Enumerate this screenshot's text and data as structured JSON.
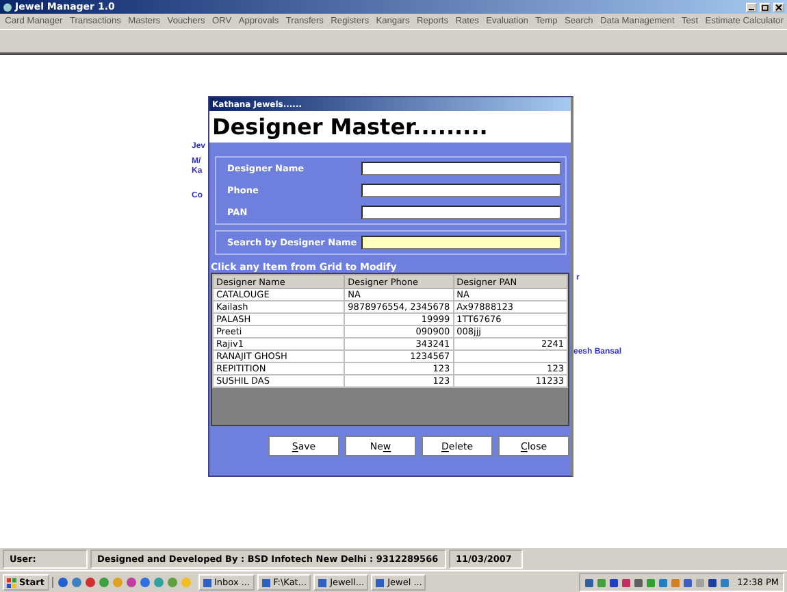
{
  "window": {
    "title": "Jewel Manager 1.0"
  },
  "menu": [
    "Card Manager",
    "Transactions",
    "Masters",
    "Vouchers",
    "ORV",
    "Approvals",
    "Transfers",
    "Registers",
    "Kangars",
    "Reports",
    "Rates",
    "Evaluation",
    "Temp",
    "Search",
    "Data Management",
    "Test",
    "Estimate Calculator"
  ],
  "background_texts": [
    "Jev",
    "M/",
    "Ka",
    "Co",
    "r",
    "eesh Bansal"
  ],
  "dialog": {
    "caption": "Kathana Jewels......",
    "heading": "Designer Master.........",
    "fields": [
      {
        "label": "Designer Name"
      },
      {
        "label": "Phone"
      },
      {
        "label": "PAN"
      }
    ],
    "search": {
      "label": "Search by Designer Name"
    },
    "hint": "Click any Item from Grid to Modify",
    "table": {
      "columns": [
        "Designer Name",
        "Designer Phone",
        "Designer PAN"
      ],
      "rows": [
        [
          "CATALOUGE",
          "NA",
          "NA"
        ],
        [
          "Kailash",
          "9878976554, 2345678",
          "Ax97888123"
        ],
        [
          "PALASH",
          "19999",
          "1TT67676"
        ],
        [
          "Preeti",
          "090900",
          "008jjj"
        ],
        [
          "Rajiv1",
          "343241",
          "2241"
        ],
        [
          "RANAJIT GHOSH",
          "1234567",
          ""
        ],
        [
          "REPITITION",
          "123",
          "123"
        ],
        [
          "SUSHIL DAS",
          "123",
          "11233"
        ]
      ]
    },
    "buttons": [
      {
        "key": "S",
        "after": "ave"
      },
      {
        "before": "Ne",
        "key": "w"
      },
      {
        "key": "D",
        "after": "elete"
      },
      {
        "key": "C",
        "after": "lose"
      }
    ]
  },
  "status_bar": {
    "user": "User:",
    "credit": "Designed and Developed By : BSD Infotech New Delhi : 9312289566",
    "date": "11/03/2007"
  },
  "taskbar": {
    "start": "Start",
    "tasks": [
      "Inbox ...",
      "F:\\Kat...",
      "Jewell...",
      "Jewel ..."
    ],
    "clock": "12:38 PM"
  }
}
